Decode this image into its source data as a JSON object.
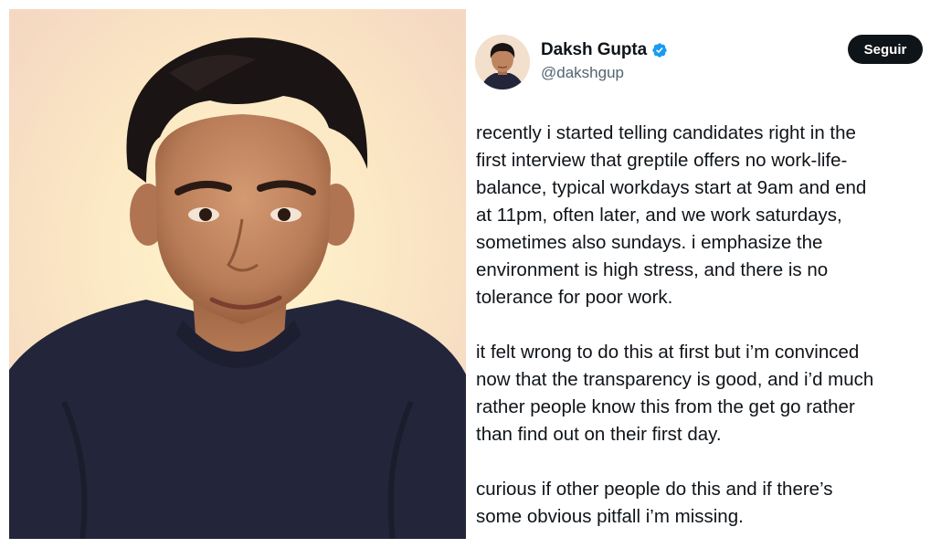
{
  "author": {
    "display_name": "Daksh Gupta",
    "handle": "@dakshgup",
    "verified": true,
    "verified_color": "#1d9bf0"
  },
  "follow_button": {
    "label": "Seguir",
    "background": "#0f1419",
    "text_color": "#ffffff"
  },
  "tweet": {
    "paragraphs": [
      {
        "lines": [
          "recently i started telling candidates right in the",
          "first interview that greptile offers no work-life-",
          "balance, typical workdays start at 9am and end",
          "at 11pm, often later, and we work saturdays,",
          "sometimes also sundays. i emphasize the",
          "environment is high stress, and there is no",
          "tolerance for poor work."
        ]
      },
      {
        "lines": [
          "it felt wrong to do this at first but i’m convinced",
          "now that the transparency is good, and i’d much",
          "rather people know this from the get go rather",
          "than find out on their first day."
        ]
      },
      {
        "lines": [
          "curious if other people do this and if there’s",
          "some obvious pitfall i’m missing."
        ]
      }
    ]
  },
  "photo": {
    "background": "#fbe7c6",
    "sweater_color": "#23253a",
    "hair_color": "#1a1414",
    "skin_color": "#c48c68"
  }
}
